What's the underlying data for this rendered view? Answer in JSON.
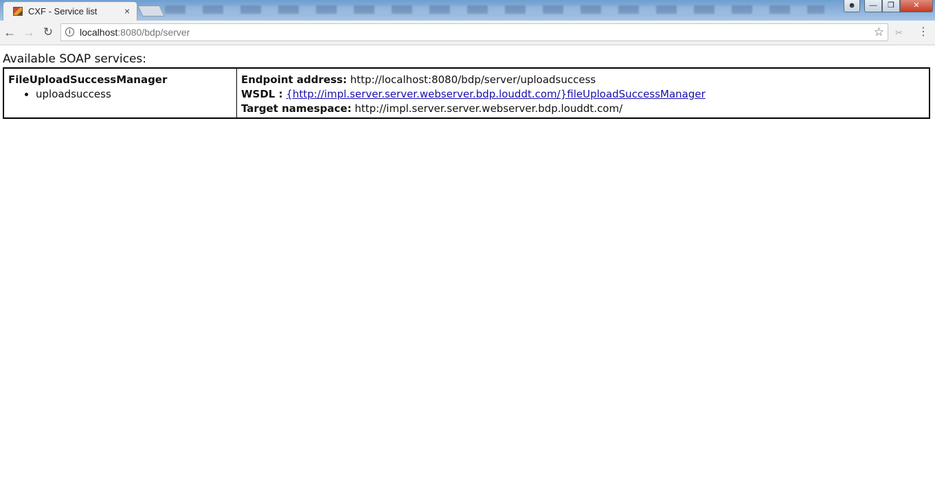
{
  "browser": {
    "tab_title": "CXF - Service list",
    "tab_close": "×",
    "url_host": "localhost",
    "url_rest": ":8080/bdp/server",
    "icons": {
      "back": "arrow-left",
      "forward": "arrow-right",
      "reload": "reload",
      "info": "info",
      "star": "star",
      "menu": "more-vert"
    }
  },
  "page": {
    "heading": "Available SOAP services:",
    "services": [
      {
        "name": "FileUploadSuccessManager",
        "operations": [
          "uploadsuccess"
        ],
        "endpoint_label": "Endpoint address:",
        "endpoint": "http://localhost:8080/bdp/server/uploadsuccess",
        "wsdl_label": "WSDL :",
        "wsdl": "{http://impl.server.server.webserver.bdp.louddt.com/}fileUploadSuccessManager",
        "namespace_label": "Target namespace:",
        "namespace": "http://impl.server.server.webserver.bdp.louddt.com/"
      }
    ]
  },
  "colors": {
    "link": "#1a0dab",
    "close_button": "#c53a22"
  }
}
